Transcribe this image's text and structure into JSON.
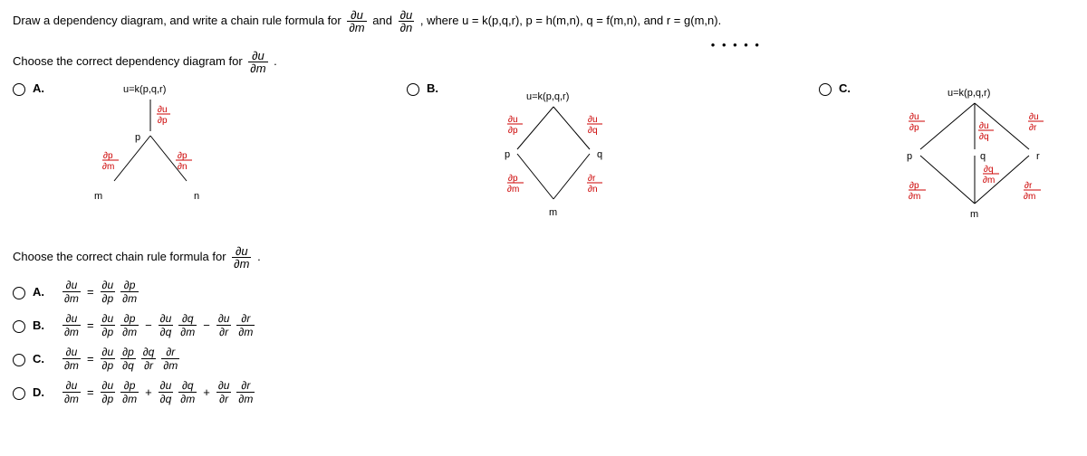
{
  "question_prefix": "Draw a dependency diagram, and write a chain rule formula for ",
  "frac1_num": "∂u",
  "frac1_den": "∂m",
  "and_word": " and ",
  "frac2_num": "∂u",
  "frac2_den": "∂n",
  "question_suffix": ", where u = k(p,q,r), p = h(m,n), q = f(m,n), and r = g(m,n).",
  "dots": "• • • • •",
  "prompt_diagram_prefix": "Choose the correct dependency diagram for ",
  "prompt_diagram_frac_num": "∂u",
  "prompt_diagram_frac_den": "∂m",
  "prompt_diagram_suffix": ".",
  "diag_labels": {
    "a": "A.",
    "b": "B.",
    "c": "C."
  },
  "diag_title": "u=k(p,q,r)",
  "d_m": "m",
  "d_n": "n",
  "d_p": "p",
  "d_q": "q",
  "d_r": "r",
  "frac_du_dp_n": "∂u",
  "frac_du_dp_d": "∂p",
  "frac_du_dq_n": "∂u",
  "frac_du_dq_d": "∂q",
  "frac_du_dr_n": "∂u",
  "frac_du_dr_d": "∂r",
  "frac_dp_dm_n": "∂p",
  "frac_dp_dm_d": "∂m",
  "frac_dp_dn_n": "∂p",
  "frac_dp_dn_d": "∂n",
  "frac_dr_dn_n": "∂r",
  "frac_dr_dn_d": "∂n",
  "frac_dr_dm_n": "∂r",
  "frac_dr_dm_d": "∂m",
  "frac_dq_dm_n": "∂q",
  "frac_dq_dm_d": "∂m",
  "prompt_chain_prefix": "Choose the correct chain rule formula for ",
  "prompt_chain_frac_num": "∂u",
  "prompt_chain_frac_den": "∂m",
  "prompt_chain_suffix": ".",
  "chain_labels": {
    "a": "A.",
    "b": "B.",
    "c": "C.",
    "d": "D."
  },
  "ch_lhs_n": "∂u",
  "ch_lhs_d": "∂m",
  "eq": "=",
  "minus": "−",
  "plus": "+",
  "t_du": "∂u",
  "t_dp": "∂p",
  "t_dq": "∂q",
  "t_dr": "∂r",
  "t_dm": "∂m"
}
